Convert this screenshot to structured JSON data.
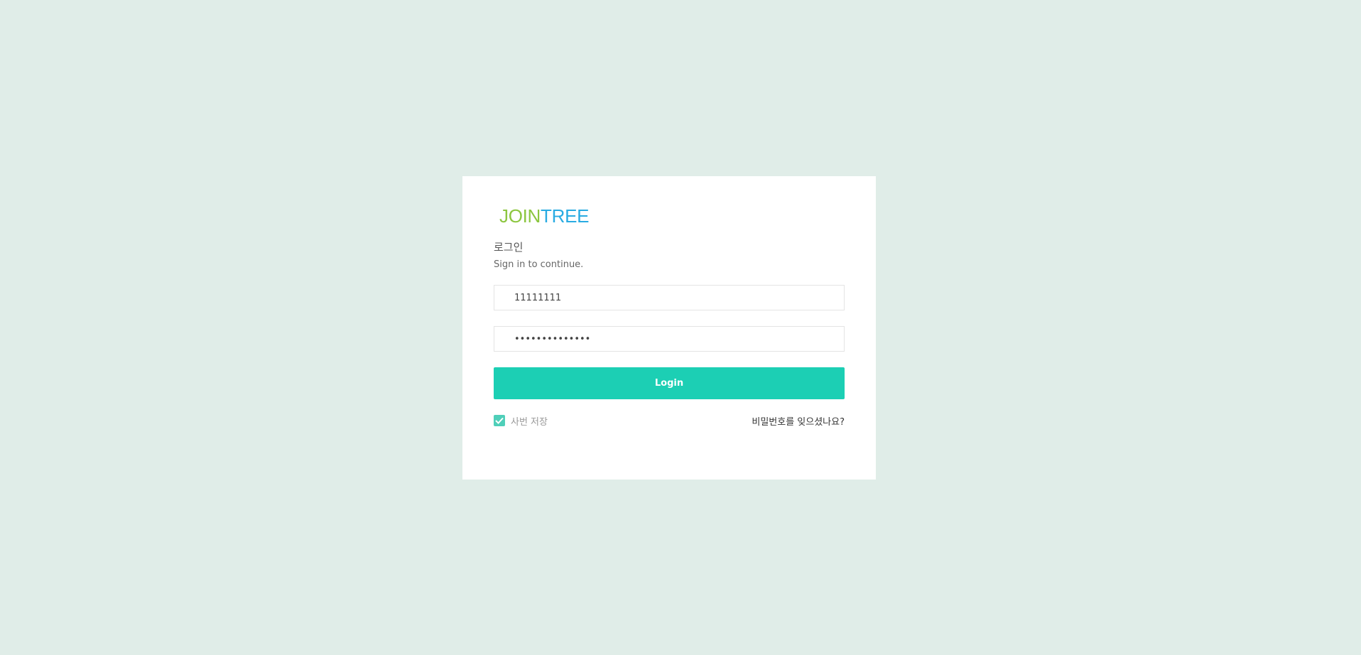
{
  "logo": {
    "part1": "JOIN",
    "part2": "TREE",
    "color1": "#8cc63f",
    "color2": "#29abe2"
  },
  "login": {
    "title": "로그인",
    "subtitle": "Sign in to continue.",
    "id_value": "11111111",
    "password_value": "••••••••••••••",
    "button_label": "Login",
    "remember_label": "사번 저장",
    "remember_checked": true,
    "forgot_link": "비밀번호를 잊으셨나요?"
  },
  "colors": {
    "background": "#e0ede8",
    "accent": "#1ccfb4"
  }
}
